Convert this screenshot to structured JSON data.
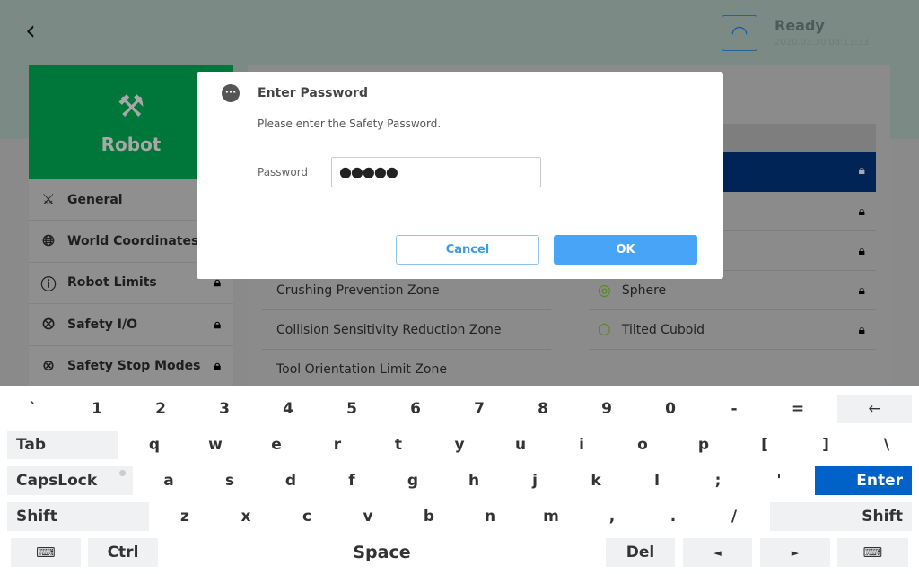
{
  "header": {
    "status": "Ready",
    "timestamp": "2020.03.30 08:13:33",
    "colors": {
      "status_icon": "#1d5aa8"
    }
  },
  "sidebar": {
    "title": "Robot",
    "accent": "#00773a",
    "items": [
      {
        "label": "General",
        "icon": "robot-arm-icon",
        "locked": false
      },
      {
        "label": "World Coordinates",
        "icon": "globe-icon",
        "locked": false
      },
      {
        "label": "Robot Limits",
        "icon": "limit-icon",
        "locked": true
      },
      {
        "label": "Safety I/O",
        "icon": "io-icon",
        "locked": true
      },
      {
        "label": "Safety Stop Modes",
        "icon": "stop-icon",
        "locked": true
      }
    ]
  },
  "main": {
    "left_rows": [
      "Crushing Prevention Zone",
      "Collision Sensitivity Reduction Zone",
      "Tool Orientation Limit Zone"
    ],
    "right_rows": [
      {
        "label": "Sphere",
        "icon": "sphere-icon"
      },
      {
        "label": "Tilted Cuboid",
        "icon": "tilted-cuboid-icon"
      }
    ]
  },
  "dialog": {
    "title": "Enter Password",
    "message": "Please enter the Safety Password.",
    "password_label": "Password",
    "password_value": "●●●●●",
    "cancel_label": "Cancel",
    "ok_label": "OK"
  },
  "keyboard": {
    "row1": [
      "`",
      "1",
      "2",
      "3",
      "4",
      "5",
      "6",
      "7",
      "8",
      "9",
      "0",
      "-",
      "="
    ],
    "backspace": "←",
    "tab": "Tab",
    "row2": [
      "q",
      "w",
      "e",
      "r",
      "t",
      "y",
      "u",
      "i",
      "o",
      "p",
      "[",
      "]",
      "\\"
    ],
    "capslock": "CapsLock",
    "row3": [
      "a",
      "s",
      "d",
      "f",
      "g",
      "h",
      "j",
      "k",
      "l",
      ";",
      "'"
    ],
    "enter": "Enter",
    "shift": "Shift",
    "row4": [
      "z",
      "x",
      "c",
      "v",
      "b",
      "n",
      "m",
      ",",
      ".",
      "/"
    ],
    "ctrl": "Ctrl",
    "space": "Space",
    "del": "Del",
    "left": "◄",
    "right": "►",
    "enter_color": "#0061c8"
  }
}
